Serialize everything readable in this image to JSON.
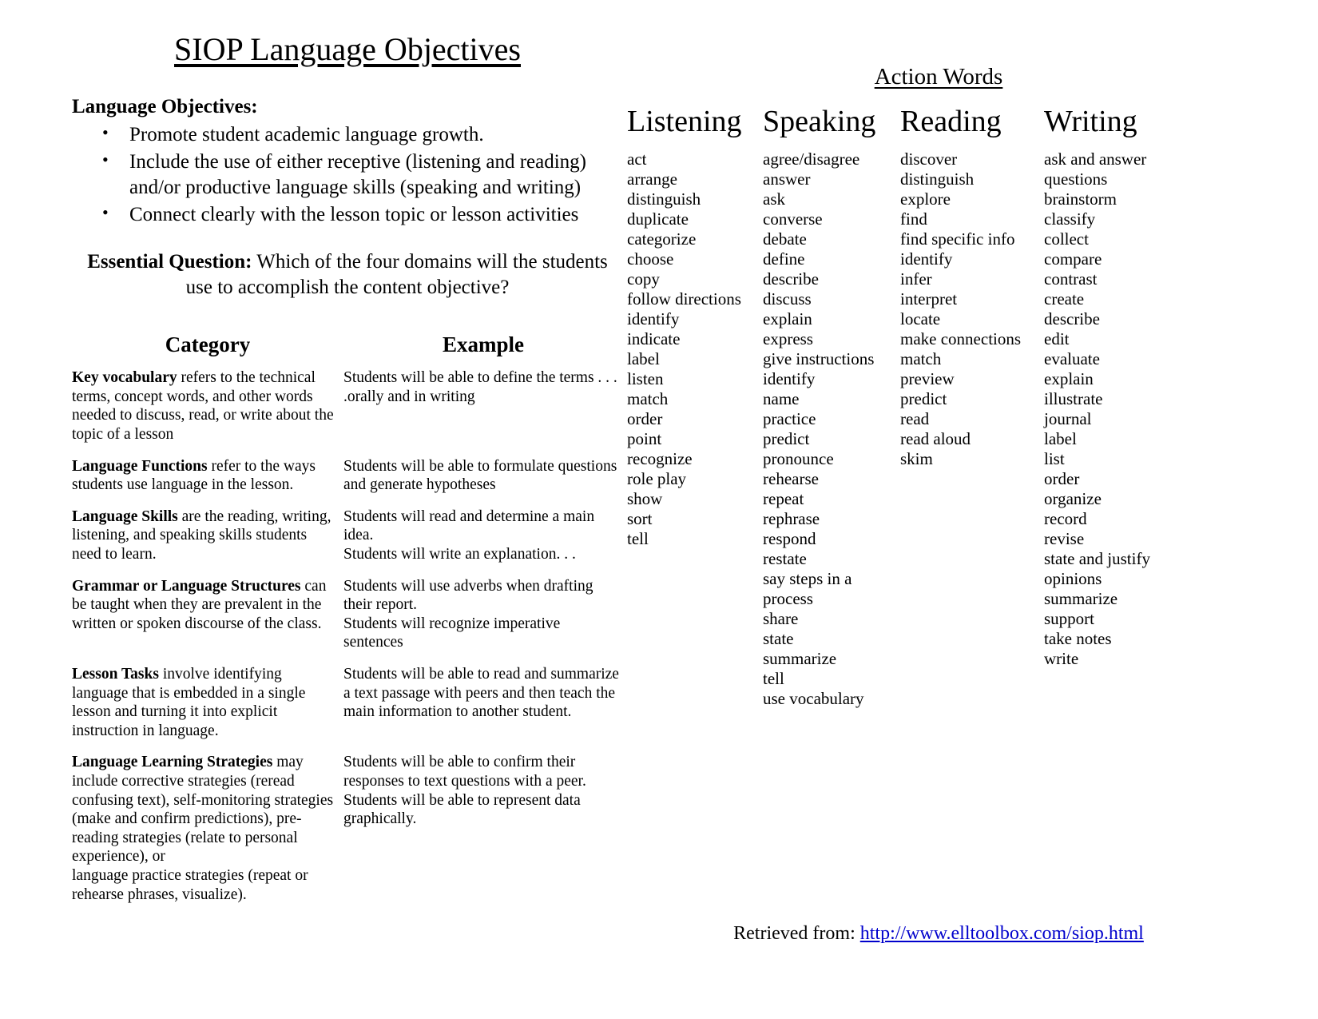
{
  "document": {
    "title": "SIOP Language Objectives"
  },
  "language_objectives": {
    "heading": "Language Objectives:",
    "bullet_glyph": "•",
    "items": [
      "Promote student academic language growth.",
      "Include the use of either receptive (listening and reading) and/or productive language skills (speaking and writing)",
      "Connect clearly with the lesson topic or lesson activities"
    ]
  },
  "essential_question": {
    "label": "Essential Question:",
    "text": " Which of the four domains will the students use to accomplish the content objective?"
  },
  "category_table": {
    "headers": {
      "category": "Category",
      "example": "Example"
    },
    "rows": [
      {
        "term": "Key vocabulary",
        "description": " refers to the technical terms, concept words, and other words needed to discuss, read, or write about the topic of a lesson",
        "example": "Students will be able to define the terms . . . .orally and in writing"
      },
      {
        "term": "Language Functions",
        "description": " refer to the ways students use language in the lesson.",
        "example": "Students will be able to formulate questions and generate hypotheses"
      },
      {
        "term": "Language Skills",
        "description": " are the reading, writing, listening, and speaking skills students need to learn.",
        "example": "Students will read and determine a main idea.\nStudents will write an explanation. . ."
      },
      {
        "term": "Grammar or Language Structures",
        "description": " can be taught when they are prevalent in the written or spoken discourse of the class.",
        "example": "Students will use adverbs when drafting their report.\nStudents will recognize imperative sentences"
      },
      {
        "term": "Lesson Tasks",
        "description": " involve identifying language that is embedded in a single lesson and turning it into explicit instruction in language.",
        "example": "Students will be able to read and summarize a text passage with peers and then teach the main information to another student."
      },
      {
        "term": "Language Learning Strategies",
        "description": " may include corrective strategies (reread confusing text), self-monitoring strategies (make and confirm predictions), pre-reading strategies (relate to personal experience), or\nlanguage practice strategies (repeat or rehearse phrases, visualize).",
        "example": "Students will be able to confirm their responses to text questions with a peer. Students will be able to represent data graphically."
      }
    ]
  },
  "action_words": {
    "title": "Action Words",
    "columns": [
      {
        "heading": "Listening",
        "words": [
          "act",
          "arrange",
          "distinguish",
          "duplicate",
          "categorize",
          "choose",
          "copy",
          "follow directions",
          "identify",
          "indicate",
          "label",
          "listen",
          "match",
          "order",
          "point",
          "recognize",
          "role play",
          "show",
          "sort",
          "tell"
        ]
      },
      {
        "heading": "Speaking",
        "words": [
          "agree/disagree",
          "answer",
          "ask",
          "converse",
          "debate",
          "define",
          "describe",
          "discuss",
          "explain",
          "express",
          "give instructions",
          "identify",
          "name",
          "practice",
          "predict",
          "pronounce",
          "rehearse",
          "repeat",
          "rephrase",
          "respond",
          "restate",
          "say steps in a",
          "process",
          "share",
          "state",
          "summarize",
          "tell",
          "use vocabulary"
        ]
      },
      {
        "heading": "Reading",
        "words": [
          "discover",
          "distinguish",
          "explore",
          "find",
          "find specific info",
          "identify",
          "infer",
          "interpret",
          "locate",
          "make connections",
          "match",
          "preview",
          "predict",
          "read",
          "read aloud",
          "skim"
        ]
      },
      {
        "heading": "Writing",
        "words": [
          "ask and answer",
          "questions",
          "brainstorm",
          "classify",
          "collect",
          "compare",
          "contrast",
          "create",
          "describe",
          "edit",
          "evaluate",
          "explain",
          "illustrate",
          "journal",
          "label",
          "list",
          "order",
          "organize",
          "record",
          "revise",
          "state and justify",
          "opinions",
          "summarize",
          "support",
          "take notes",
          "write"
        ]
      }
    ]
  },
  "footer": {
    "prefix": "Retrieved from: ",
    "link_text": "http://www.elltoolbox.com/siop.html",
    "link_color": "#0000cc"
  }
}
